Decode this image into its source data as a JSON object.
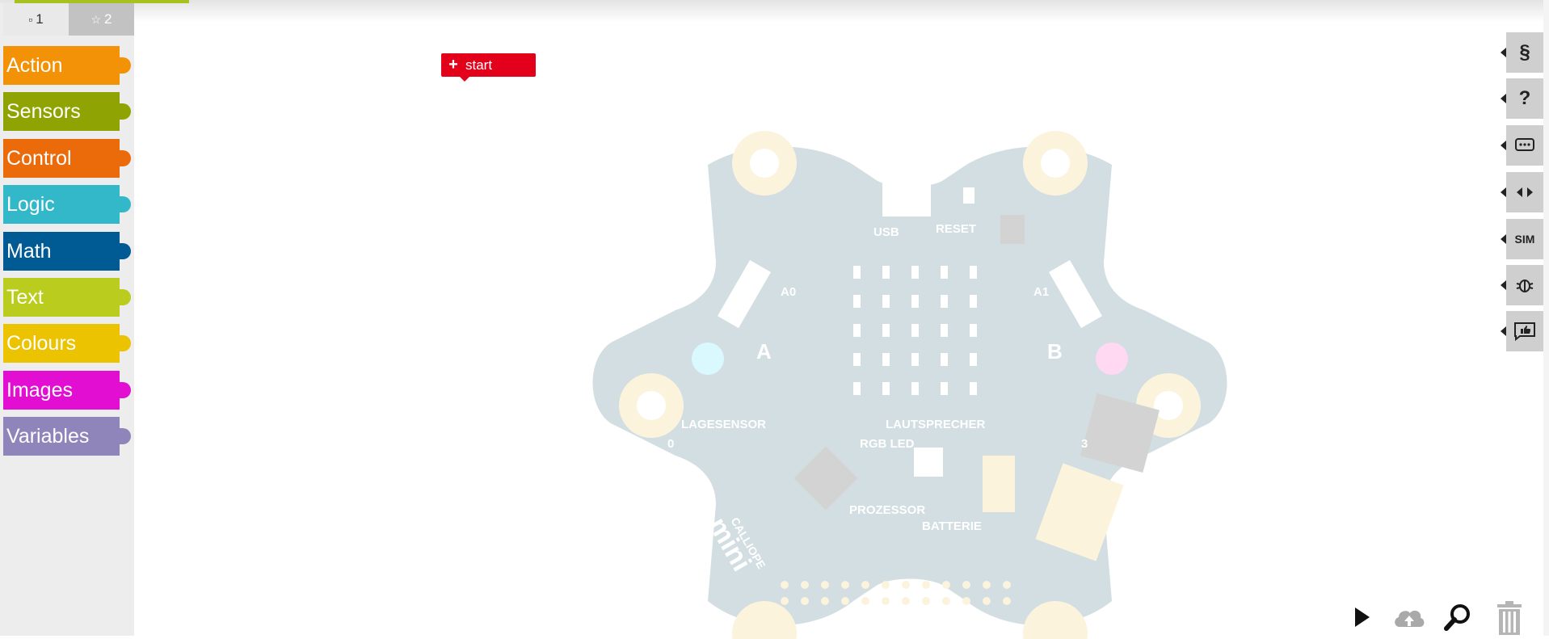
{
  "toolbox": {
    "tabs": [
      {
        "label": "1",
        "icon": "square-icon"
      },
      {
        "label": "2",
        "icon": "star-icon"
      }
    ],
    "categories": [
      {
        "label": "Action",
        "color": "#f39206"
      },
      {
        "label": "Sensors",
        "color": "#8fa402"
      },
      {
        "label": "Control",
        "color": "#eb6a0a"
      },
      {
        "label": "Logic",
        "color": "#33b8ca"
      },
      {
        "label": "Math",
        "color": "#005a94"
      },
      {
        "label": "Text",
        "color": "#bacc1e"
      },
      {
        "label": "Colours",
        "color": "#ebc300"
      },
      {
        "label": "Images",
        "color": "#e20ed2"
      },
      {
        "label": "Variables",
        "color": "#9085ba"
      }
    ]
  },
  "workspace": {
    "start_block": {
      "label": "start",
      "color": "#e2001a"
    },
    "board": {
      "labels": {
        "minus": "−",
        "plus": "+",
        "usb": "USB",
        "reset": "RESET",
        "a0": "A0",
        "a1": "A1",
        "a": "A",
        "b": "B",
        "lagesensor": "LAGESENSOR",
        "lautsprecher": "LAUTSPRECHER",
        "rgb_led": "RGB LED",
        "prozessor": "PROZESSOR",
        "batterie": "BATTERIE",
        "pin0": "0",
        "pin3": "3",
        "calliope": "CALLIOPE",
        "mini": "mini"
      }
    }
  },
  "side_buttons": [
    {
      "name": "program-button",
      "label": "§"
    },
    {
      "name": "help-button",
      "label": "?"
    },
    {
      "name": "info-button",
      "label": "ooo"
    },
    {
      "name": "code-button",
      "label": "<>"
    },
    {
      "name": "sim-button",
      "label": "SIM"
    },
    {
      "name": "debug-button",
      "label": "bug"
    },
    {
      "name": "feedback-button",
      "label": "like"
    }
  ]
}
